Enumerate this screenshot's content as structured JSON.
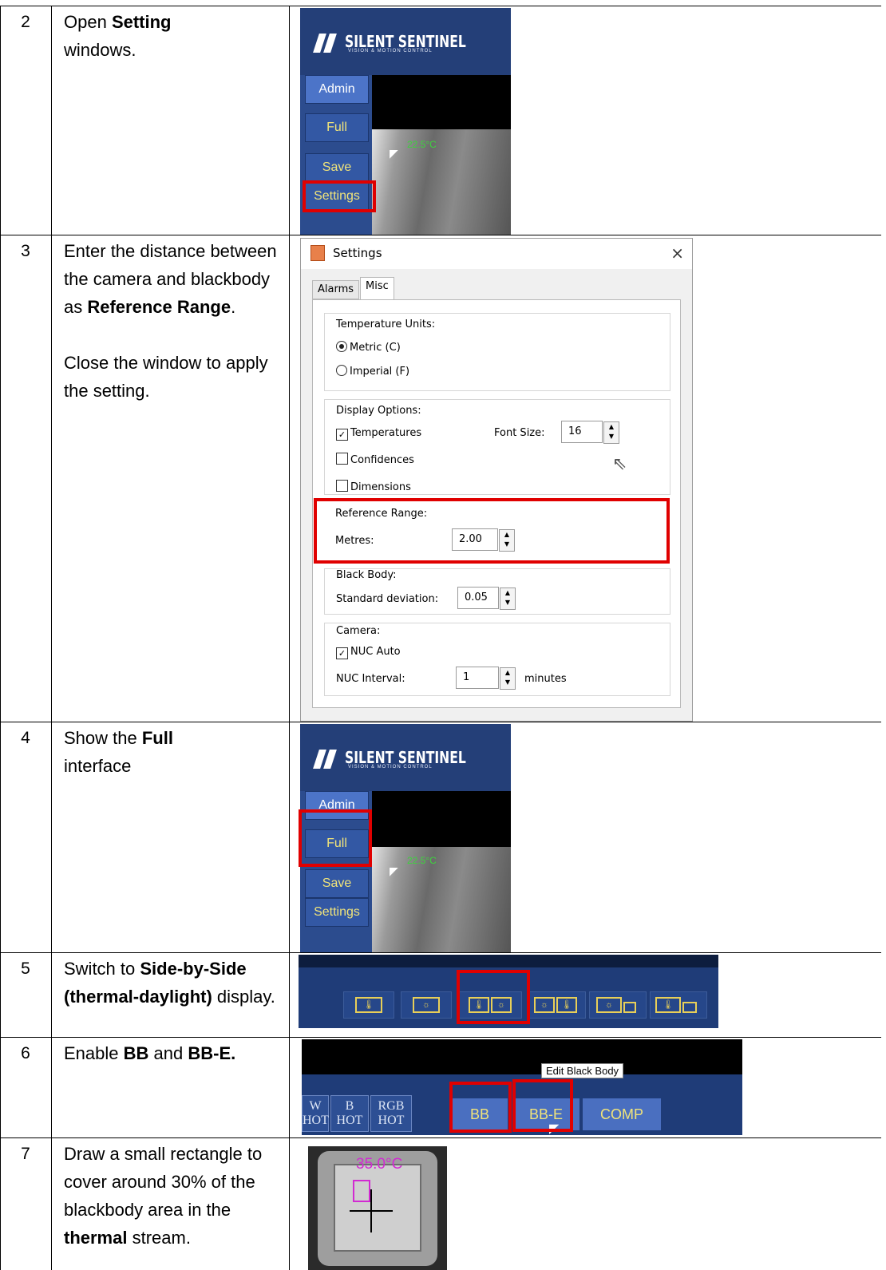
{
  "rows": [
    {
      "num": "2",
      "p1": {
        "a": "Open ",
        "b": "Setting",
        "c": " windows."
      }
    },
    {
      "num": "3",
      "p1": {
        "a": "Enter the distance between the camera and blackbody as ",
        "b": "Reference Range",
        "c": "."
      },
      "p2": "Close the window to apply the setting."
    },
    {
      "num": "4",
      "p1": {
        "a": "Show the ",
        "b": "Full",
        "c": " interface"
      }
    },
    {
      "num": "5",
      "p1": {
        "a": "Switch to ",
        "b": "Side-by-Side (thermal-daylight)",
        "c": " display."
      }
    },
    {
      "num": "6",
      "p1": {
        "a": "Enable ",
        "b": "BB",
        "c": " and ",
        "d": "BB-E."
      }
    },
    {
      "num": "7",
      "p1": {
        "a": "Draw a small rectangle to cover around 30% of the blackbody area in the ",
        "b": "thermal",
        "c": " stream."
      }
    }
  ],
  "app": {
    "brand": "SILENT SENTINEL",
    "tagline": "VISION & MOTION CONTROL",
    "buttons": {
      "admin": "Admin",
      "full": "Full",
      "save": "Save",
      "settings": "Settings"
    },
    "overlay_temp": "22.5°C"
  },
  "settings_dialog": {
    "title": "Settings",
    "close": "×",
    "tabs": [
      "Alarms",
      "Misc"
    ],
    "temperature_units": {
      "title": "Temperature Units:",
      "metric": "Metric (C)",
      "imperial": "Imperial (F)",
      "selected": "Metric (C)"
    },
    "display_options": {
      "title": "Display Options:",
      "temperatures": "Temperatures",
      "confidences": "Confidences",
      "dimensions": "Dimensions",
      "temperatures_checked": true,
      "confidences_checked": false,
      "dimensions_checked": false,
      "font_size_label": "Font Size:",
      "font_size": "16"
    },
    "reference_range": {
      "title": "Reference Range:",
      "label": "Metres:",
      "value": "2.00"
    },
    "black_body": {
      "title": "Black Body:",
      "label": "Standard deviation:",
      "value": "0.05"
    },
    "camera": {
      "title": "Camera:",
      "nuc_auto": "NUC Auto",
      "nuc_auto_checked": true,
      "interval_label": "NUC Interval:",
      "interval": "1",
      "unit": "minutes"
    }
  },
  "toolbar6": {
    "hot_buttons": [
      [
        "W",
        "HOT"
      ],
      [
        "B",
        "HOT"
      ],
      [
        "RGB",
        "HOT"
      ]
    ],
    "bb": "BB",
    "bbe": "BB-E",
    "comp": "COMP",
    "tooltip": "Edit Black Body"
  },
  "thermal_thumb": {
    "temp": "35.0°C"
  },
  "colors": {
    "highlight": "#e00000",
    "app_blue": "#243f78",
    "button_text": "#f1e47a"
  }
}
